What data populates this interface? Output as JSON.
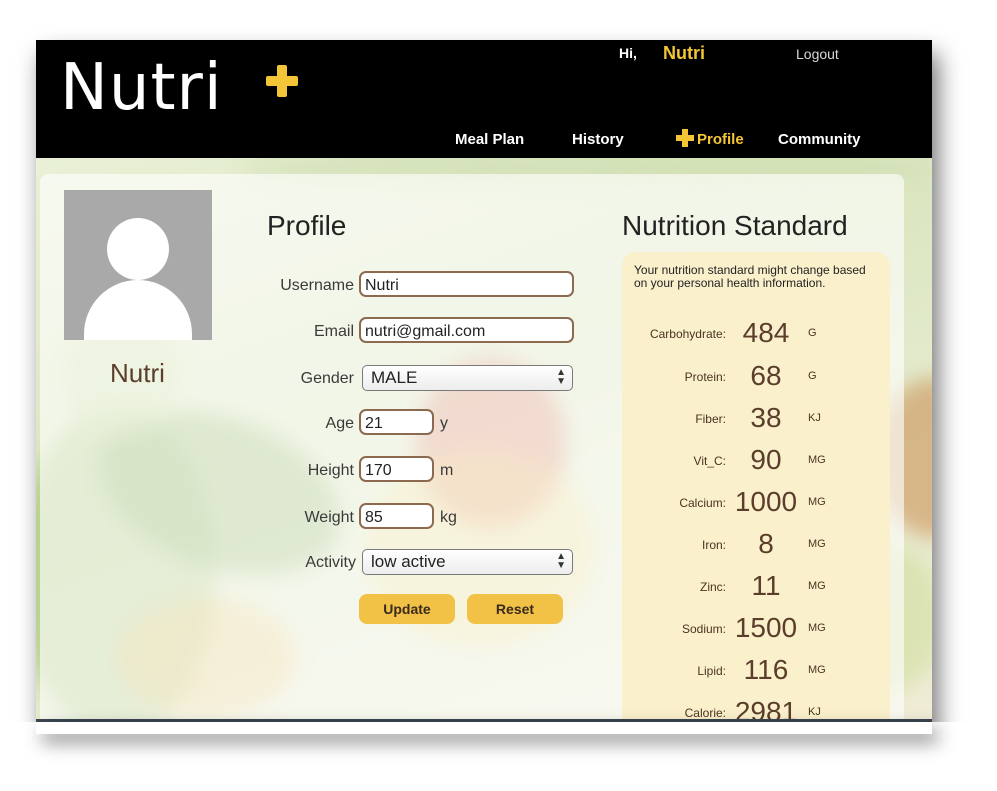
{
  "brand": {
    "name": "Nutri",
    "accent_color": "#f4c536"
  },
  "header": {
    "greeting": "Hi,",
    "user": "Nutri",
    "logout": "Logout",
    "nav": [
      {
        "label": "Meal Plan",
        "active": false
      },
      {
        "label": "History",
        "active": false
      },
      {
        "label": "Profile",
        "active": true,
        "icon": "plus-icon"
      },
      {
        "label": "Community",
        "active": false
      }
    ]
  },
  "sidebar": {
    "avatar_icon": "user-avatar-icon",
    "name": "Nutri"
  },
  "profile": {
    "title": "Profile",
    "fields": {
      "username": {
        "label": "Username",
        "value": "Nutri"
      },
      "email": {
        "label": "Email",
        "value": "nutri@gmail.com"
      },
      "gender": {
        "label": "Gender",
        "value": "MALE"
      },
      "age": {
        "label": "Age",
        "value": "21",
        "unit": "y"
      },
      "height": {
        "label": "Height",
        "value": "170",
        "unit": "m"
      },
      "weight": {
        "label": "Weight",
        "value": "85",
        "unit": "kg"
      },
      "activity": {
        "label": "Activity",
        "value": "low active"
      }
    },
    "buttons": {
      "update": "Update",
      "reset": "Reset"
    }
  },
  "nutrition": {
    "title": "Nutrition Standard",
    "note": "Your nutrition standard might change based on your personal health information.",
    "items": [
      {
        "label": "Carbohydrate:",
        "value": "484",
        "unit": "G"
      },
      {
        "label": "Protein:",
        "value": "68",
        "unit": "G"
      },
      {
        "label": "Fiber:",
        "value": "38",
        "unit": "KJ"
      },
      {
        "label": "Vit_C:",
        "value": "90",
        "unit": "MG"
      },
      {
        "label": "Calcium:",
        "value": "1000",
        "unit": "MG"
      },
      {
        "label": "Iron:",
        "value": "8",
        "unit": "MG"
      },
      {
        "label": "Zinc:",
        "value": "11",
        "unit": "MG"
      },
      {
        "label": "Sodium:",
        "value": "1500",
        "unit": "MG"
      },
      {
        "label": "Lipid:",
        "value": "116",
        "unit": "MG"
      },
      {
        "label": "Calorie:",
        "value": "2981",
        "unit": "KJ"
      }
    ]
  }
}
